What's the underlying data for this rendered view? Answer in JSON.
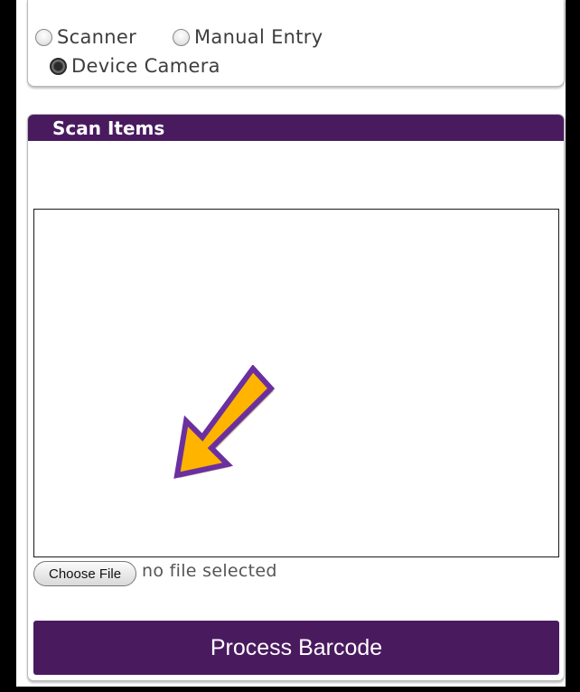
{
  "input_mode": {
    "options": [
      {
        "label": "Scanner",
        "selected": false
      },
      {
        "label": "Manual Entry",
        "selected": false
      },
      {
        "label": "Device Camera",
        "selected": true
      }
    ]
  },
  "scan_section": {
    "title": "Scan Items",
    "file_input": {
      "button_label": "Choose File",
      "status": "no file selected"
    },
    "process_button_label": "Process Barcode"
  },
  "colors": {
    "brand_purple": "#4a1a5f",
    "arrow_fill": "#ffb400",
    "arrow_outline": "#6b2fa0"
  },
  "icons": {
    "arrow": "arrow-down-left-icon"
  }
}
